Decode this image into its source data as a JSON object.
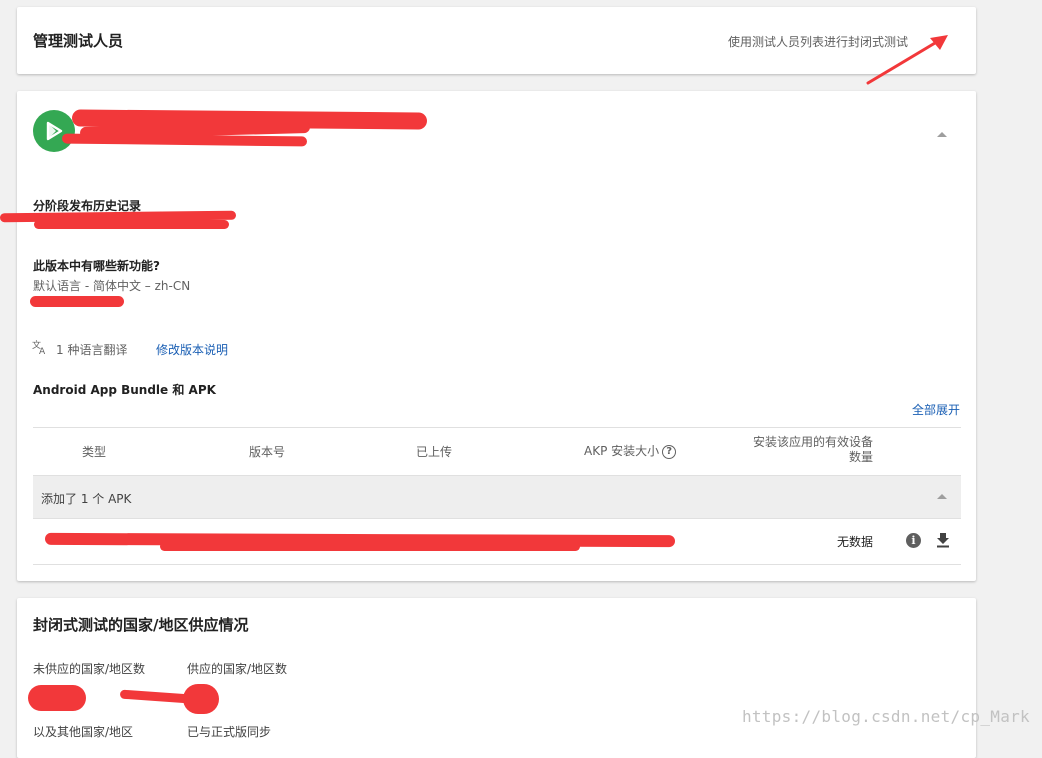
{
  "testers_card": {
    "title": "管理测试人员",
    "hint": "使用测试人员列表进行封闭式测试"
  },
  "release_card": {
    "history_label": "分阶段发布历史记录",
    "whats_new_label": "此版本中有哪些新功能?",
    "default_language": "默认语言 - 简体中文 – zh-CN",
    "translations_count": "1 种语言翻译",
    "edit_release_notes": "修改版本说明",
    "bundle_title": "Android App Bundle 和 APK",
    "expand_all": "全部展开",
    "table": {
      "columns": [
        "类型",
        "版本号",
        "已上传",
        "AKP 安装大小",
        "安装该应用的有效设备数量"
      ],
      "active_devices_line1": "安装该应用的有效设备",
      "active_devices_line2": "数量",
      "group_label": "添加了 1 个 APK",
      "row_no_data": "无数据",
      "help_glyph": "?",
      "info_glyph": "i"
    }
  },
  "availability_card": {
    "title": "封闭式测试的国家/地区供应情况",
    "unavailable_label": "未供应的国家/地区数",
    "available_label": "供应的国家/地区数",
    "other_countries": "以及其他国家/地区",
    "synced": "已与正式版同步"
  },
  "watermark": "https://blog.csdn.net/cp_Mark",
  "colors": {
    "accent_link": "#1a5fb4",
    "app_icon_bg": "#34a853",
    "annotation_red": "#f2383a",
    "background": "#f1f1f1"
  },
  "icons": [
    "dropdown-icon",
    "app-icon",
    "collapse-icon",
    "translate-icon",
    "help-icon",
    "info-icon",
    "download-icon",
    "annotation-arrow-icon"
  ]
}
